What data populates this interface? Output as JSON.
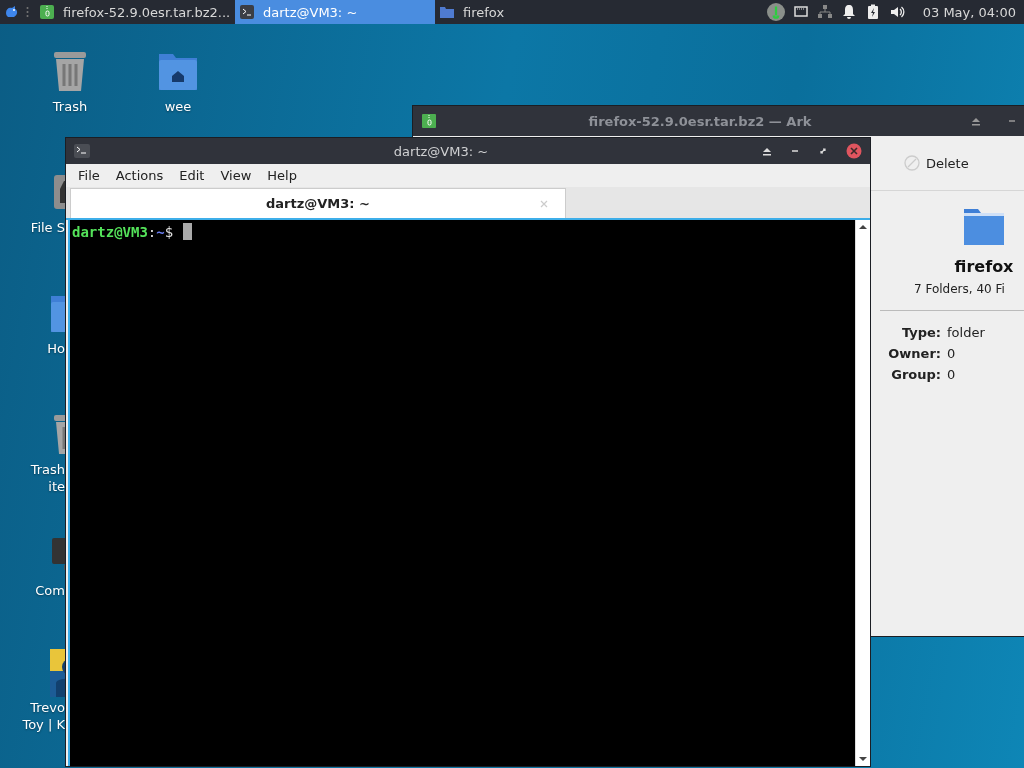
{
  "taskbar": {
    "tasks": [
      {
        "label": "firefox-52.9.0esr.tar.bz2...",
        "kind": "archive",
        "selected": false
      },
      {
        "label": "dartz@VM3: ~",
        "kind": "terminal",
        "selected": true
      },
      {
        "label": "firefox",
        "kind": "folder",
        "selected": false
      }
    ],
    "clock": "03 May, 04:00"
  },
  "desktop": {
    "columns": [
      [
        {
          "lines": [
            "Trash"
          ],
          "kind": "trash"
        },
        {
          "lines": [
            "File S"
          ],
          "kind": "drive"
        },
        {
          "lines": [
            "Ho"
          ],
          "kind": "folder"
        },
        {
          "lines": [
            "Trash",
            "ite"
          ],
          "kind": "trash"
        },
        {
          "lines": [
            "Com"
          ],
          "kind": "computer"
        },
        {
          "lines": [
            "Trevo",
            "Toy | K"
          ],
          "kind": "picture"
        }
      ],
      [
        {
          "lines": [
            "wee"
          ],
          "kind": "home"
        }
      ]
    ]
  },
  "ark": {
    "title": "firefox-52.9.0esr.tar.bz2 — Ark",
    "toolbar": [
      "Delete"
    ],
    "name": "firefox",
    "summary": "7 Folders, 40 Fi",
    "properties": [
      {
        "label": "Type:",
        "value": "folder"
      },
      {
        "label": "Owner:",
        "value": "0"
      },
      {
        "label": "Group:",
        "value": "0"
      }
    ]
  },
  "terminal": {
    "title": "dartz@VM3: ~",
    "menu": [
      "File",
      "Actions",
      "Edit",
      "View",
      "Help"
    ],
    "tabs": [
      {
        "label": "dartz@VM3: ~",
        "selected": true
      }
    ],
    "prompt": {
      "user_host": "dartz@VM3",
      "separator": ":",
      "path": "~",
      "symbol": "$"
    }
  }
}
